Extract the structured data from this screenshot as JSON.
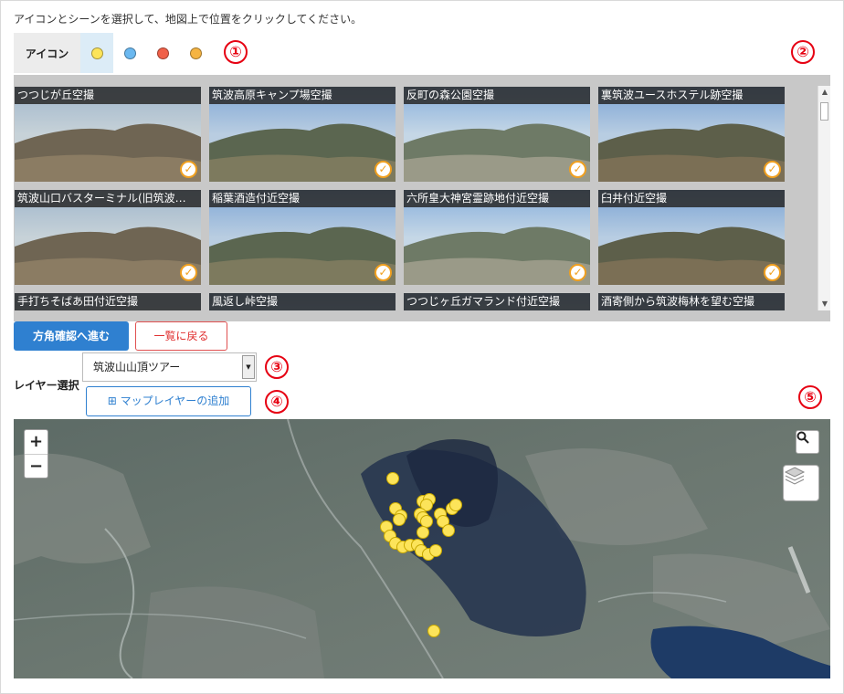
{
  "instruction": "アイコンとシーンを選択して、地図上で位置をクリックしてください。",
  "callouts": [
    "①",
    "②",
    "③",
    "④",
    "⑤"
  ],
  "icon_bar": {
    "label": "アイコン",
    "options": [
      {
        "name": "yellow",
        "color": "#fce45a",
        "selected": true
      },
      {
        "name": "blue",
        "color": "#6ab8f0",
        "selected": false
      },
      {
        "name": "red",
        "color": "#f06048",
        "selected": false
      },
      {
        "name": "orange",
        "color": "#f5b442",
        "selected": false
      }
    ]
  },
  "scenes": [
    {
      "title": "つつじが丘空撮"
    },
    {
      "title": "筑波高原キャンプ場空撮"
    },
    {
      "title": "反町の森公園空撮"
    },
    {
      "title": "裏筑波ユースホステル跡空撮"
    },
    {
      "title": "筑波山口バスターミナル(旧筑波…"
    },
    {
      "title": "稲葉酒造付近空撮"
    },
    {
      "title": "六所皇大神宮霊跡地付近空撮"
    },
    {
      "title": "臼井付近空撮"
    },
    {
      "title": "手打ちそばあ田付近空撮"
    },
    {
      "title": "風返し峠空撮"
    },
    {
      "title": "つつじヶ丘ガマランド付近空撮"
    },
    {
      "title": "酒寄側から筑波梅林を望む空撮"
    }
  ],
  "buttons": {
    "confirm": "方角確認へ進む",
    "back": "一覧に戻る",
    "add_layer": "⊞ マップレイヤーの追加"
  },
  "layer": {
    "label": "レイヤー選択",
    "selected": "筑波山山頂ツアー"
  },
  "map": {
    "zoom_in": "+",
    "zoom_out": "−",
    "marker_color": "#fce45a"
  }
}
